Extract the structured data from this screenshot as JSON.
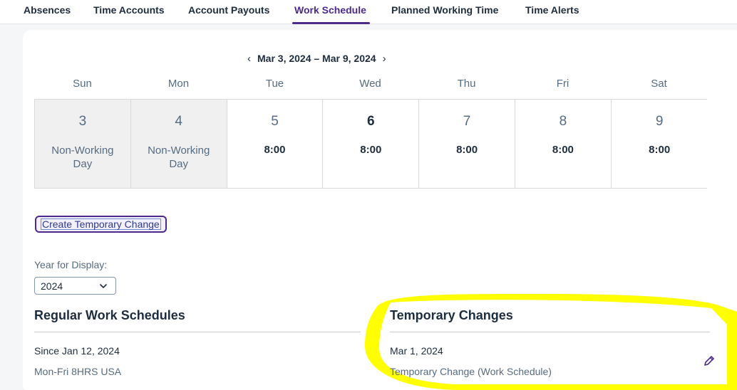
{
  "tabs": [
    {
      "label": "Absences"
    },
    {
      "label": "Time Accounts"
    },
    {
      "label": "Account Payouts"
    },
    {
      "label": "Work Schedule",
      "active": true
    },
    {
      "label": "Planned Working Time"
    },
    {
      "label": "Time Alerts"
    }
  ],
  "week": {
    "range": "Mar 3, 2024 – Mar 9, 2024",
    "prev_icon": "chevron-left-icon",
    "next_icon": "chevron-right-icon",
    "days": [
      {
        "name": "Sun",
        "date": "3",
        "status": "Non-Working Day",
        "working": false
      },
      {
        "name": "Mon",
        "date": "4",
        "status": "Non-Working Day",
        "working": false
      },
      {
        "name": "Tue",
        "date": "5",
        "hours": "8:00",
        "working": true
      },
      {
        "name": "Wed",
        "date": "6",
        "hours": "8:00",
        "working": true,
        "today": true
      },
      {
        "name": "Thu",
        "date": "7",
        "hours": "8:00",
        "working": true
      },
      {
        "name": "Fri",
        "date": "8",
        "hours": "8:00",
        "working": true
      },
      {
        "name": "Sat",
        "date": "9",
        "hours": "8:00",
        "working": true
      }
    ]
  },
  "actions": {
    "create_temporary_change": "Create Temporary Change"
  },
  "year_display": {
    "label": "Year for Display:",
    "value": "2024"
  },
  "regular": {
    "title": "Regular Work Schedules",
    "entry_date": "Since Jan 12, 2024",
    "entry_name": "Mon-Fri 8HRS USA"
  },
  "temporary": {
    "title": "Temporary Changes",
    "entry_date": "Mar 1, 2024",
    "entry_name": "Temporary Change (Work Schedule)",
    "edit_icon": "pencil-icon"
  },
  "colors": {
    "accent": "#4b2a8c",
    "highlight": "#ffff00",
    "nonworking_bg": "#f0f0f0"
  }
}
